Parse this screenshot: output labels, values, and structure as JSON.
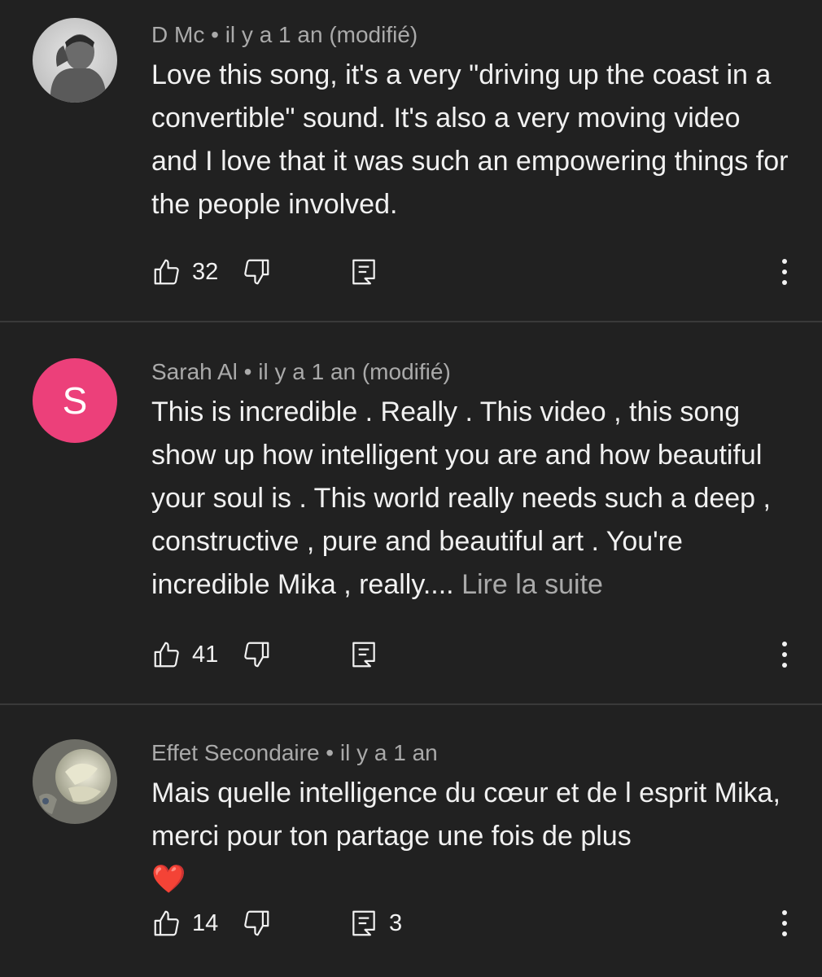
{
  "comments": [
    {
      "author": "D Mc",
      "separator": "•",
      "time": "il y a 1 an (modifié)",
      "text": "Love this song, it's a very \"driving up the coast in a convertible\" sound.  It's also a very moving video and I love that it was such an empowering things for the people involved.",
      "likes": "32",
      "replies": "",
      "avatar_type": "photo"
    },
    {
      "author": "Sarah Al",
      "separator": "•",
      "time": "il y a 1 an (modifié)",
      "text": "This is incredible . Really . This video , this song show up how intelligent you are and how beautiful your soul is . This world really needs such a deep , constructive , pure and beautiful art . You're incredible Mika , really....",
      "read_more": "Lire la suite",
      "likes": "41",
      "replies": "",
      "avatar_letter": "S",
      "avatar_color": "#ec407a"
    },
    {
      "author": "Effet Secondaire",
      "separator": "•",
      "time": "il y a 1 an",
      "text": "Mais quelle intelligence du cœur et de l esprit Mika, merci pour ton partage une fois de plus",
      "emoji": "❤️",
      "likes": "14",
      "replies": "3",
      "avatar_type": "photo"
    }
  ],
  "icons": {
    "like": "thumb-up-icon",
    "dislike": "thumb-down-icon",
    "reply": "reply-comment-icon",
    "menu": "more-vertical-icon"
  },
  "colors": {
    "background": "#212121",
    "text": "#f1f1f1",
    "meta": "#aaaaaa",
    "avatar_s": "#ec407a",
    "heart": "#e53935"
  }
}
